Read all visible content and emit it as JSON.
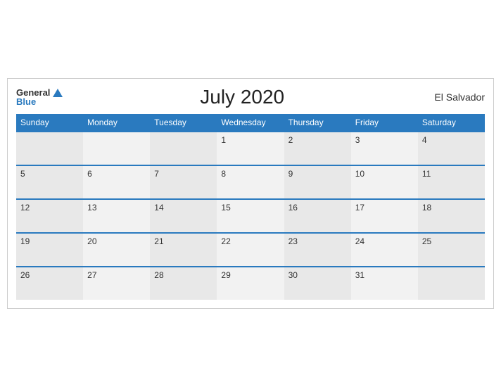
{
  "header": {
    "logo_general": "General",
    "logo_blue": "Blue",
    "title": "July 2020",
    "country": "El Salvador"
  },
  "weekdays": [
    "Sunday",
    "Monday",
    "Tuesday",
    "Wednesday",
    "Thursday",
    "Friday",
    "Saturday"
  ],
  "weeks": [
    [
      null,
      null,
      null,
      1,
      2,
      3,
      4
    ],
    [
      5,
      6,
      7,
      8,
      9,
      10,
      11
    ],
    [
      12,
      13,
      14,
      15,
      16,
      17,
      18
    ],
    [
      19,
      20,
      21,
      22,
      23,
      24,
      25
    ],
    [
      26,
      27,
      28,
      29,
      30,
      31,
      null
    ]
  ]
}
